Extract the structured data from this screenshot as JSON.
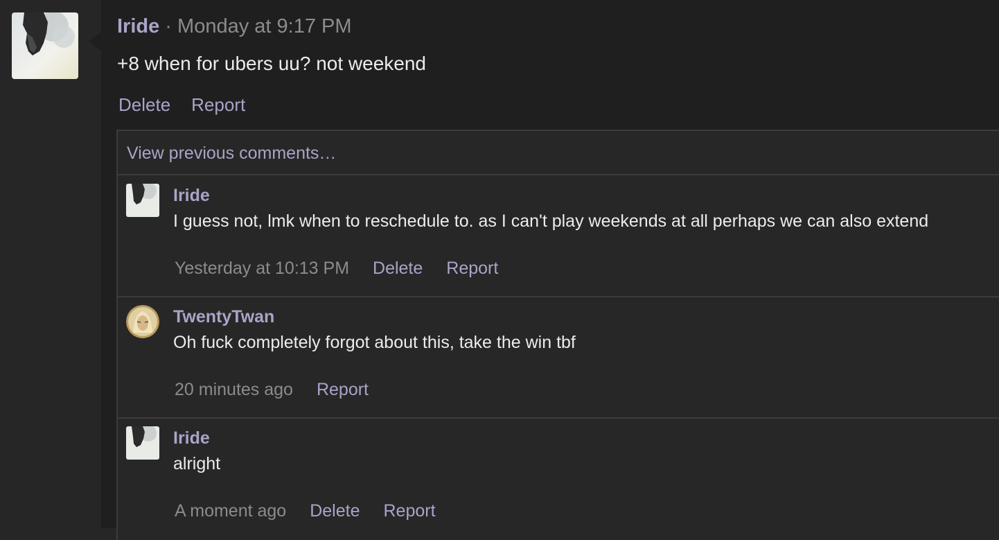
{
  "post": {
    "author": "Iride",
    "separator": " · ",
    "timestamp": "Monday at 9:17 PM",
    "body": "+8 when for ubers uu? not weekend",
    "actions": {
      "delete": "Delete",
      "report": "Report"
    }
  },
  "comments_section": {
    "view_previous": "View previous comments…",
    "comments": [
      {
        "author": "Iride",
        "text": "I guess not, lmk when to reschedule to. as I can't play weekends at all perhaps we can also extend",
        "time": "Yesterday at 10:13 PM",
        "delete": "Delete",
        "report": "Report"
      },
      {
        "author": "TwentyTwan",
        "text": "Oh fuck completely forgot about this, take the win tbf",
        "time": "20 minutes ago",
        "report": "Report"
      },
      {
        "author": "Iride",
        "text": "alright",
        "time": "A moment ago",
        "delete": "Delete",
        "report": "Report"
      }
    ]
  },
  "colors": {
    "link": "#a9a4c8",
    "background": "#1f1f1f",
    "gutter": "#262626",
    "meta": "#8c8c8c",
    "text": "#ececec"
  }
}
